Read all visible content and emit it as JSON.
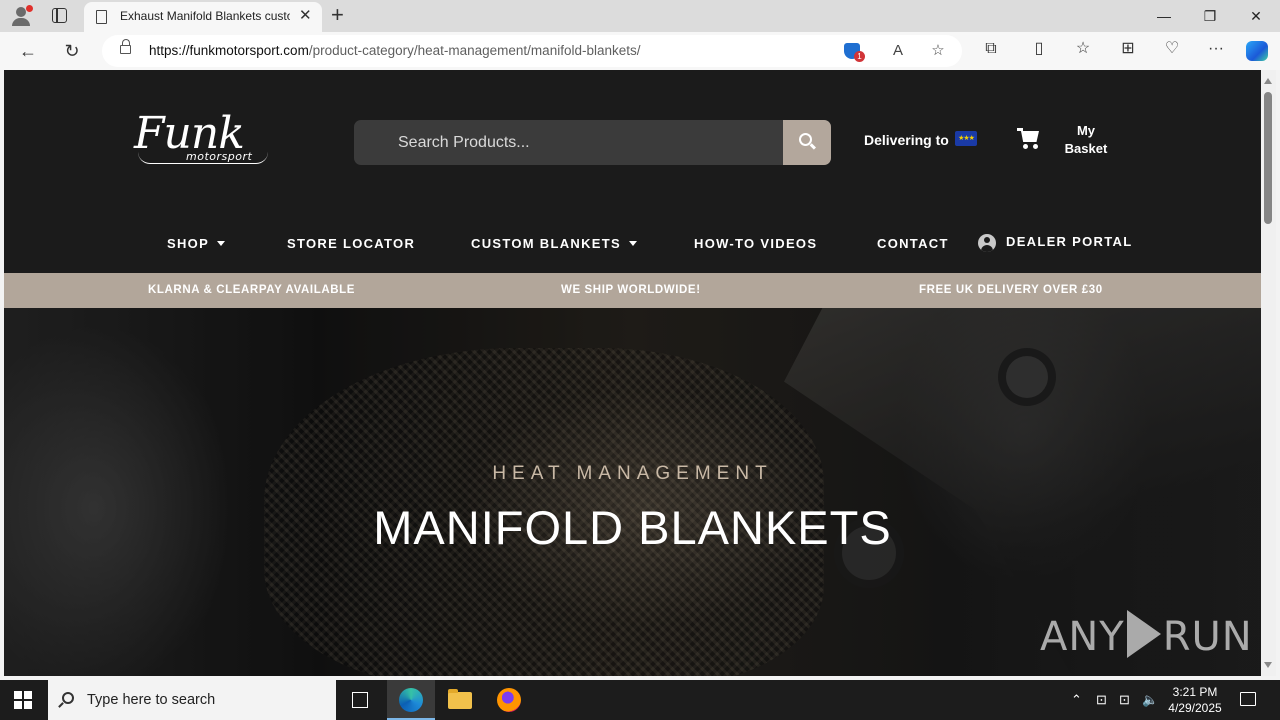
{
  "browser": {
    "tab_title": "Exhaust Manifold Blankets custom",
    "tab_close": "✕",
    "new_tab": "+",
    "url_domain": "https://funkmotorsport.com",
    "url_path": "/product-category/heat-management/manifold-blankets/",
    "shield_count": "1",
    "window_controls": {
      "minimize": "—",
      "restore": "❐",
      "close": "✕"
    },
    "nav_icons": {
      "back": "←",
      "reload": "↻"
    },
    "omni_icons": {
      "read_aloud": "A",
      "favorite": "☆"
    },
    "toolbar_icons": {
      "extensions": "⧉",
      "split": "▯",
      "favorites": "☆",
      "collections": "⊞",
      "performance": "♡",
      "menu": "···"
    }
  },
  "site": {
    "logo": {
      "script": "Funk",
      "sub": "motorsport"
    },
    "search": {
      "placeholder": "Search Products..."
    },
    "delivering_label": "Delivering to",
    "flag_stars": "★★★",
    "basket": {
      "line1": "My",
      "line2": "Basket"
    },
    "nav": {
      "shop": "SHOP",
      "store_locator": "STORE LOCATOR",
      "custom_blankets": "CUSTOM BLANKETS",
      "how_to_videos": "HOW-TO VIDEOS",
      "contact": "CONTACT",
      "dealer_portal": "DEALER PORTAL"
    },
    "promo": {
      "klarna": "KLARNA & CLEARPAY AVAILABLE",
      "worldwide": "WE SHIP WORLDWIDE!",
      "free_delivery": "FREE UK DELIVERY OVER £30"
    },
    "hero": {
      "eyebrow": "HEAT MANAGEMENT",
      "title": "MANIFOLD BLANKETS"
    },
    "watermark": {
      "left": "ANY",
      "right": "RUN"
    }
  },
  "taskbar": {
    "search_placeholder": "Type here to search",
    "tray": {
      "chevron": "⌃",
      "network": "⊡",
      "volume": "🔈"
    },
    "time": "3:21 PM",
    "date": "4/29/2025"
  }
}
